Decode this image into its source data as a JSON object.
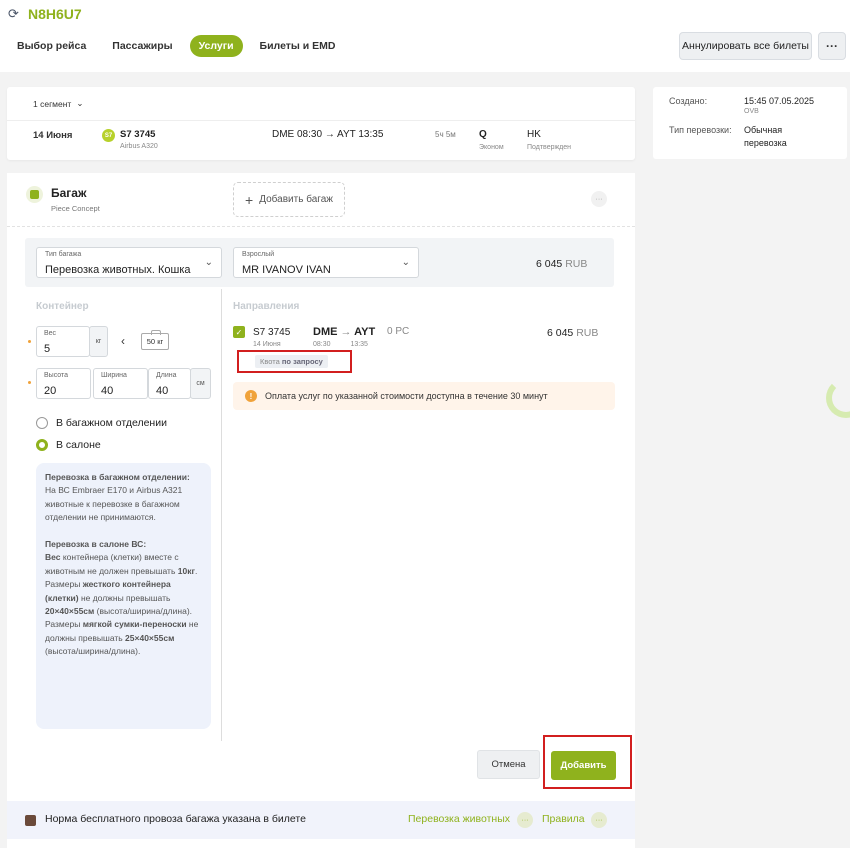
{
  "header": {
    "pnr": "N8H6U7",
    "tabs": [
      "Выбор рейса",
      "Пассажиры",
      "Услуги",
      "Билеты и EMD"
    ],
    "active_tab": 2,
    "cancel_all_label": "Аннулировать все билеты",
    "more_label": "···"
  },
  "segment": {
    "selector_label": "1 сегмент",
    "date": "14 Июня",
    "airline_logo": "S7",
    "flight": "S7 3745",
    "aircraft": "Airbus A320",
    "route": "DME 08:30",
    "route_arrow": "→",
    "route_arrival": "AYT 13:35",
    "duration": "5ч 5м",
    "class_code": "Q",
    "class_name": "Эконом",
    "status_code": "HK",
    "status_name": "Подтвержден"
  },
  "info": {
    "created_label": "Создано:",
    "created_value": "15:45 07.05.2025",
    "created_sub": "OVB",
    "type_label": "Тип перевозки:",
    "type_value_1": "Обычная",
    "type_value_2": "перевозка"
  },
  "baggage": {
    "title": "Багаж",
    "subtitle": "Piece Concept",
    "add_label": "Добавить багаж",
    "more_label": "···",
    "type_select": {
      "label": "Тип багажа",
      "value": "Перевозка животных. Кошка"
    },
    "passenger_select": {
      "label": "Взрослый",
      "value": "MR IVANOV IVAN"
    },
    "price": "6 045",
    "currency": "RUB",
    "container_title": "Контейнер",
    "weight": {
      "label": "Вес",
      "value": "5",
      "unit": "кг"
    },
    "weight_limit": "50 кг",
    "height": {
      "label": "Высота",
      "value": "20"
    },
    "width": {
      "label": "Ширина",
      "value": "40"
    },
    "length": {
      "label": "Длина",
      "value": "40"
    },
    "dim_unit": "см",
    "radio_hold": "В багажном отделении",
    "radio_cabin": "В салоне",
    "info": {
      "h1": "Перевозка в багажном отделении:",
      "t1": "На ВС Embraer E170 и Airbus A321 животные к перевозке в багажном отделении не принимаются.",
      "h2": "Перевозка в салоне ВС:",
      "t2a": "Вес",
      "t2b": " контейнера (клетки) вместе с животным не должен превышать ",
      "t2c": "10кг",
      "t2d": ".",
      "t3a": "Размеры ",
      "t3b": "жесткого контейнера (клетки)",
      "t3c": " не должны превышать ",
      "t3d": "20×40×55см",
      "t3e": " (высота/ширина/длина).",
      "t4a": "Размеры ",
      "t4b": "мягкой сумки-переноски",
      "t4c": " не должны превышать ",
      "t4d": "25×40×55см",
      "t4e": " (высота/ширина/длина)."
    },
    "directions_title": "Направления",
    "direction": {
      "flight": "S7 3745",
      "date": "14 Июня",
      "from": "DME",
      "arrow": "→",
      "to": "AYT",
      "dep_time": "08:30",
      "arr_time": "13:35",
      "pieces": "0 PC",
      "price": "6 045",
      "currency": "RUB",
      "quota_label": "Квота",
      "quota_value": "по запросу"
    },
    "alert_text": "Оплата услуг по указанной стоимости доступна в течение 30 минут",
    "cancel_label": "Отмена",
    "add_button_label": "Добавить",
    "footer_text": "Норма бесплатного провоза багажа указана в билете",
    "footer_link_animals": "Перевозка животных",
    "footer_link_rules": "Правила",
    "footer_more": "···"
  },
  "colors": {
    "accent": "#8fb21d",
    "highlight": "#d21f1f",
    "warning": "#f0a23a"
  }
}
